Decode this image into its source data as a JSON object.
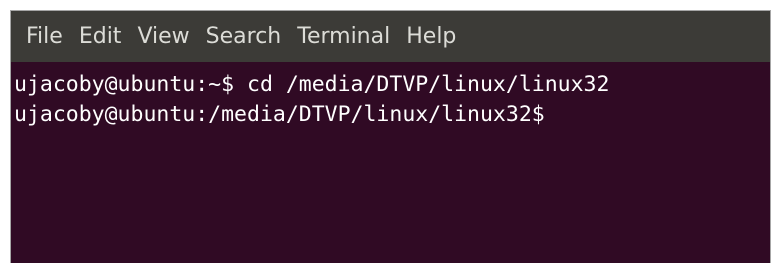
{
  "menu": {
    "items": [
      "File",
      "Edit",
      "View",
      "Search",
      "Terminal",
      "Help"
    ]
  },
  "terminal": {
    "lines": [
      "ujacoby@ubuntu:~$ cd /media/DTVP/linux/linux32",
      "ujacoby@ubuntu:/media/DTVP/linux/linux32$"
    ]
  },
  "colors": {
    "background": "#300a24",
    "menubar": "#3c3b37",
    "menu_text": "#dcdcd7",
    "text": "#ffffff"
  }
}
